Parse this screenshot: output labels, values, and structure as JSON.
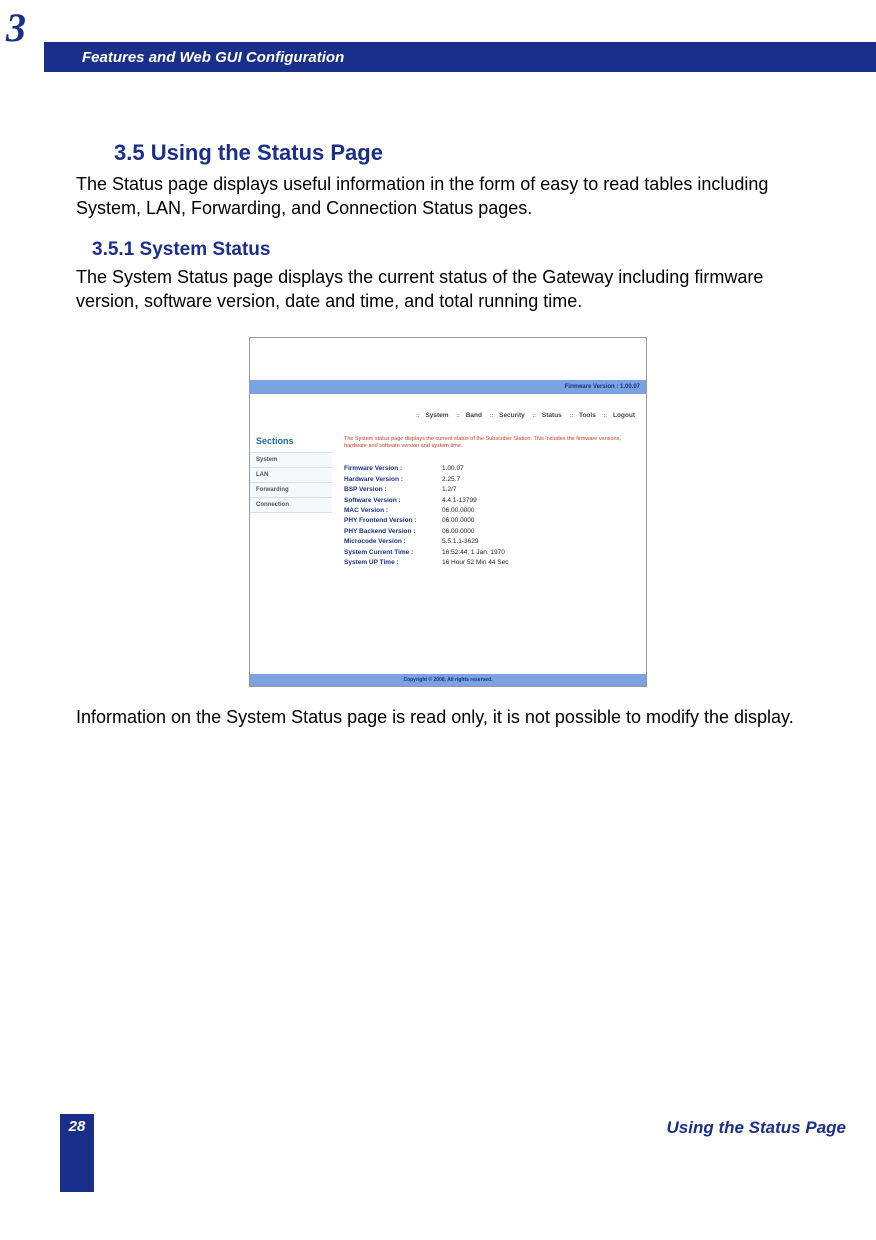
{
  "chapter_number": "3",
  "header_title": "Features and Web GUI Configuration",
  "section_heading": "3.5 Using the Status Page",
  "section_intro": "The Status page displays useful information in the form of easy to read tables including System, LAN, Forwarding, and Connection Status pages.",
  "subsection_heading": "3.5.1 System Status",
  "subsection_intro": "The System Status page displays the current status of the Gateway including firmware version, software version, date and time, and total running time.",
  "closing_para": "Information on the System Status page is read only, it is not possible to modify the display.",
  "footer": {
    "page_number": "28",
    "section_title": "Using the Status Page"
  },
  "screenshot": {
    "firmware_banner": "Firmware Version : 1.00.07",
    "menu": [
      "System",
      "Band",
      "Security",
      "Status",
      "Tools",
      "Logout"
    ],
    "sidebar_title": "Sections",
    "sidebar_items": [
      "System",
      "LAN",
      "Forwarding",
      "Connection"
    ],
    "description": "The System status page displays the current status of the Subscriber Station. This includes the firmware versions, hardware and software version and system time.",
    "rows": [
      {
        "k": "Firmware Version :",
        "v": "1.00.07"
      },
      {
        "k": "Hardware Version :",
        "v": "2.25.7"
      },
      {
        "k": "BSP Version :",
        "v": "1.2/7"
      },
      {
        "k": "Software Version :",
        "v": "4.4.1-13799"
      },
      {
        "k": "MAC Version :",
        "v": "06.00.0000"
      },
      {
        "k": "PHY Frontend Version :",
        "v": "06.00.0000"
      },
      {
        "k": "PHY Backend Version :",
        "v": "06.00.0000"
      },
      {
        "k": "Microcode Version :",
        "v": "5.5.1.1-3629"
      },
      {
        "k": "System Current Time :",
        "v": "16:52:44, 1 Jan. 1970"
      },
      {
        "k": "System UP Time :",
        "v": "16 Hour 52 Min 44 Sec"
      }
    ],
    "copyright": "Copyright © 2008.  All rights reserved."
  }
}
